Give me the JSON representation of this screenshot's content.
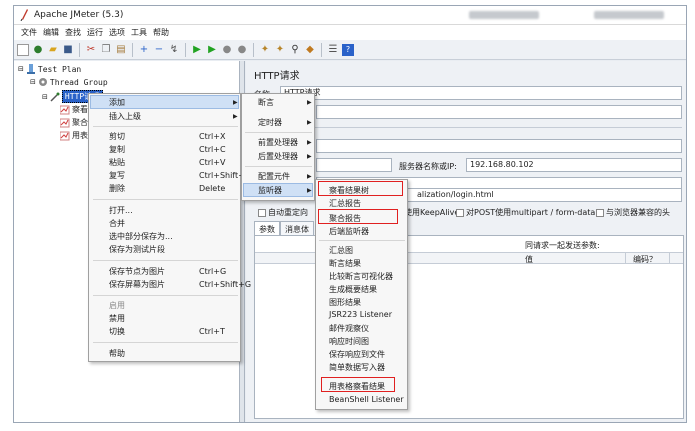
{
  "window": {
    "title": "Apache JMeter (5.3)"
  },
  "menubar": [
    "文件",
    "编辑",
    "查找",
    "运行",
    "选项",
    "工具",
    "帮助"
  ],
  "toolbar_icons": [
    "new-icon",
    "templates-icon",
    "open-icon",
    "save-icon",
    "cut-icon",
    "copy-icon",
    "paste-icon",
    "expand-icon",
    "collapse-icon",
    "toggle-icon",
    "start-icon",
    "start-no-timers-icon",
    "stop-icon",
    "shutdown-icon",
    "clear-icon",
    "clear-all-icon",
    "search-icon",
    "reset-search-icon",
    "function-helper-icon",
    "help-icon"
  ],
  "tree": {
    "test_plan": "Test Plan",
    "thread_group": "Thread Group",
    "http_request": "HTTP请求",
    "children": [
      "察看",
      "聚合",
      "用表"
    ]
  },
  "right_pane": {
    "title": "HTTP请求",
    "name_label": "名称:",
    "name_value": "HTTP请求",
    "server_label": "服务器名称或IP:",
    "server_value": "192.168.80.102",
    "path_value": "alization/login.html",
    "keepalive_label": "使用KeepAlive",
    "auto_redirect_label": "自动重定向",
    "multipart_label": "对POST使用multipart / form-data",
    "browser_headers_label": "与浏览器兼容的头",
    "tab_params": "参数",
    "tab_body": "消息体",
    "send_params_label": "同请求一起发送参数:",
    "col_value": "值",
    "col_encode": "编码？"
  },
  "context_menu": {
    "items": [
      {
        "label": "添加",
        "submenu": true
      },
      {
        "label": "插入上级",
        "submenu": true
      },
      {
        "label": "剪切",
        "shortcut": "Ctrl+X"
      },
      {
        "label": "复制",
        "shortcut": "Ctrl+C"
      },
      {
        "label": "粘贴",
        "shortcut": "Ctrl+V"
      },
      {
        "label": "复写",
        "shortcut": "Ctrl+Shift+C"
      },
      {
        "label": "删除",
        "shortcut": "Delete"
      },
      {
        "label": "打开..."
      },
      {
        "label": "合并"
      },
      {
        "label": "选中部分保存为..."
      },
      {
        "label": "保存为测试片段"
      },
      {
        "label": "保存节点为图片",
        "shortcut": "Ctrl+G"
      },
      {
        "label": "保存屏幕为图片",
        "shortcut": "Ctrl+Shift+G"
      },
      {
        "label": "启用",
        "disabled": true
      },
      {
        "label": "禁用"
      },
      {
        "label": "切换",
        "shortcut": "Ctrl+T"
      },
      {
        "label": "帮助"
      }
    ]
  },
  "add_submenu": {
    "items": [
      "断言",
      "定时器",
      "前置处理器",
      "后置处理器",
      "配置元件",
      "监听器"
    ]
  },
  "listener_submenu": {
    "items": [
      "察看结果树",
      "汇总报告",
      "聚合报告",
      "后端监听器",
      "汇总图",
      "断言结果",
      "比较断言可视化器",
      "生成概要结果",
      "图形结果",
      "JSR223 Listener",
      "邮件观察仪",
      "响应时间图",
      "保存响应到文件",
      "简单数据写入器",
      "用表格察看结果",
      "BeanShell Listener"
    ],
    "highlighted": [
      "察看结果树",
      "聚合报告",
      "用表格察看结果"
    ]
  },
  "colors": {
    "highlight_box": "#e02020",
    "selection": "#cfe0f5"
  }
}
